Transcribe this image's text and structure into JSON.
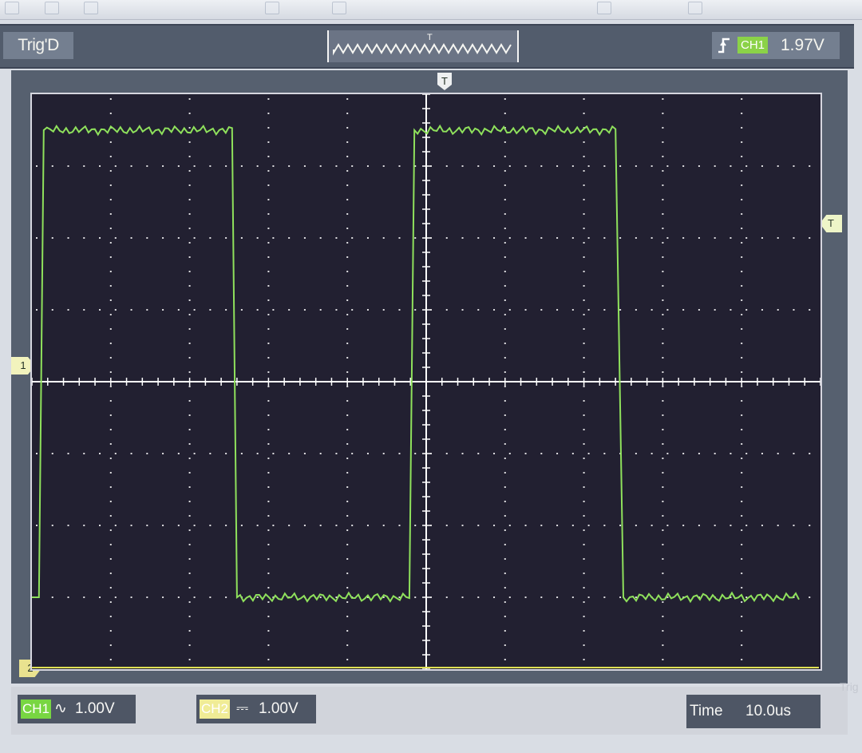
{
  "toolbar": {
    "icons": [
      "open-icon",
      "save-icon",
      "copy-icon",
      "print-icon",
      "cursor-icon",
      "zoom-icon",
      "settings-icon"
    ]
  },
  "trigger": {
    "status": "Trig'D",
    "marker": "T",
    "edge": "rising-edge-icon",
    "channel": "CH1",
    "level": "1.97V"
  },
  "display": {
    "right_trigger_marker": "T",
    "ch1_marker": "1",
    "ch2_marker": "2",
    "colors": {
      "background": "#222031",
      "grid": "#ffffff",
      "ch1": "#8fe15c",
      "ch2": "#dfe054",
      "frame": "#56606f"
    },
    "ch1_trace": {
      "waveform": "square",
      "low_level_div": -3,
      "high_level_div": 3.5,
      "edges_div": [
        -4.85,
        -2.4,
        -0.15,
        2.5
      ]
    },
    "ch2_trace": {
      "waveform": "flat",
      "level_div": -4
    }
  },
  "channels": [
    {
      "label": "CH1",
      "coupling": "∿",
      "scale": "1.00V",
      "color": "#78d642",
      "text_color": "#ffffff"
    },
    {
      "label": "CH2",
      "coupling": "⎓",
      "scale": "1.00V",
      "color": "#f0ec96",
      "text_color": "#ffffff"
    }
  ],
  "timebase": {
    "label": "Time",
    "value": "10.0us"
  },
  "background_text": [
    "Trig"
  ]
}
